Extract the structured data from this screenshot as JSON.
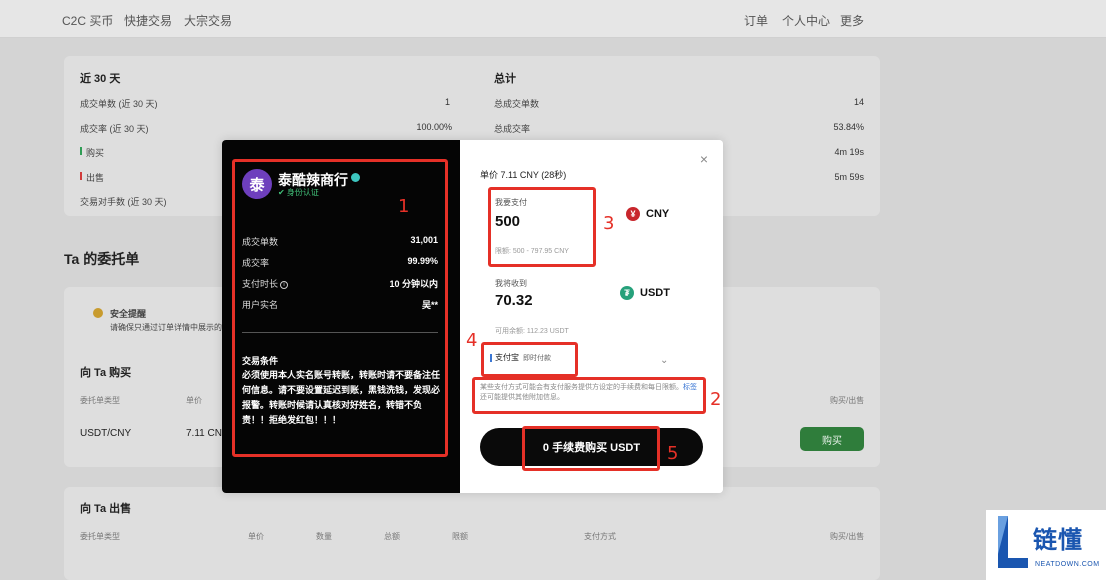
{
  "topnav": {
    "left": [
      "C2C 买币",
      "快捷交易",
      "大宗交易"
    ],
    "right": [
      "订单",
      "个人中心",
      "更多"
    ]
  },
  "stats30": {
    "title": "近 30 天",
    "rows": [
      {
        "label": "成交单数 (近 30 天)",
        "value": "1"
      },
      {
        "label": "成交率 (近 30 天)",
        "value": "100.00%"
      },
      {
        "label": "购买",
        "value": ""
      },
      {
        "label": "出售",
        "value": ""
      },
      {
        "label": "交易对手数 (近 30 天)",
        "value": ""
      }
    ]
  },
  "statsTotal": {
    "title": "总计",
    "rows": [
      {
        "label": "总成交单数",
        "value": "14"
      },
      {
        "label": "总成交率",
        "value": "53.84%"
      },
      {
        "label": "",
        "value": "4m 19s"
      },
      {
        "label": "",
        "value": "5m 59s"
      }
    ]
  },
  "orders": {
    "title": "Ta 的委托单",
    "safety_title": "安全提醒",
    "safety_text": "请确保只通过订单详情中展示的",
    "buy_section": "向 Ta 购买",
    "sell_section": "向 Ta 出售",
    "col_type": "委托单类型",
    "col_price": "单价",
    "col_action": "购买/出售",
    "row_pair": "USDT/CNY",
    "row_price": "7.11 CNY",
    "buy_button": "购买",
    "sell_cols": [
      "委托单类型",
      "单价",
      "数量",
      "总额",
      "限额",
      "支付方式",
      "购买/出售"
    ]
  },
  "modal": {
    "merchant": {
      "avatar_char": "泰",
      "name": "泰酷辣商行",
      "verified": "✔ 身份认证",
      "stats": [
        {
          "label": "成交单数",
          "value": "31,001"
        },
        {
          "label": "成交率",
          "value": "99.99%"
        },
        {
          "label": "支付时长",
          "value": "10 分钟以内"
        },
        {
          "label": "用户实名",
          "value": "吴**"
        }
      ],
      "terms_title": "交易条件",
      "terms_body": "必须使用本人实名账号转账，转账时请不要备注任何信息。请不要设置延迟到账，黑钱洗钱，发现必报警。转账时候请认真核对好姓名，转错不负责！！拒绝发红包！！！"
    },
    "unit_price": "单价 7.11 CNY (28秒)",
    "pay_label": "我要支付",
    "pay_amount": "500",
    "pay_hint": "限额: 500 - 797.95 CNY",
    "pay_currency": "CNY",
    "receive_label": "我将收到",
    "receive_amount": "70.32",
    "receive_currency": "USDT",
    "available": "可用余额: 112.23 USDT",
    "method": "支付宝",
    "method_sub": "即时付款",
    "note": "某些支付方式可能会有支付服务提供方设定的手续费和每日限额。",
    "note_link": "标签",
    "note_tail": "还可能提供其他附加信息。",
    "cta": "0 手续费购买 USDT",
    "close": "×"
  },
  "annotations": [
    "1",
    "2",
    "3",
    "4",
    "5"
  ],
  "watermark": {
    "cn": "链懂",
    "en": "NEATDOWN.COM"
  },
  "colors": {
    "annotation": "#e53027",
    "buy": "#2f7d3b",
    "link": "#3b77d4",
    "verified": "#42c27a"
  }
}
